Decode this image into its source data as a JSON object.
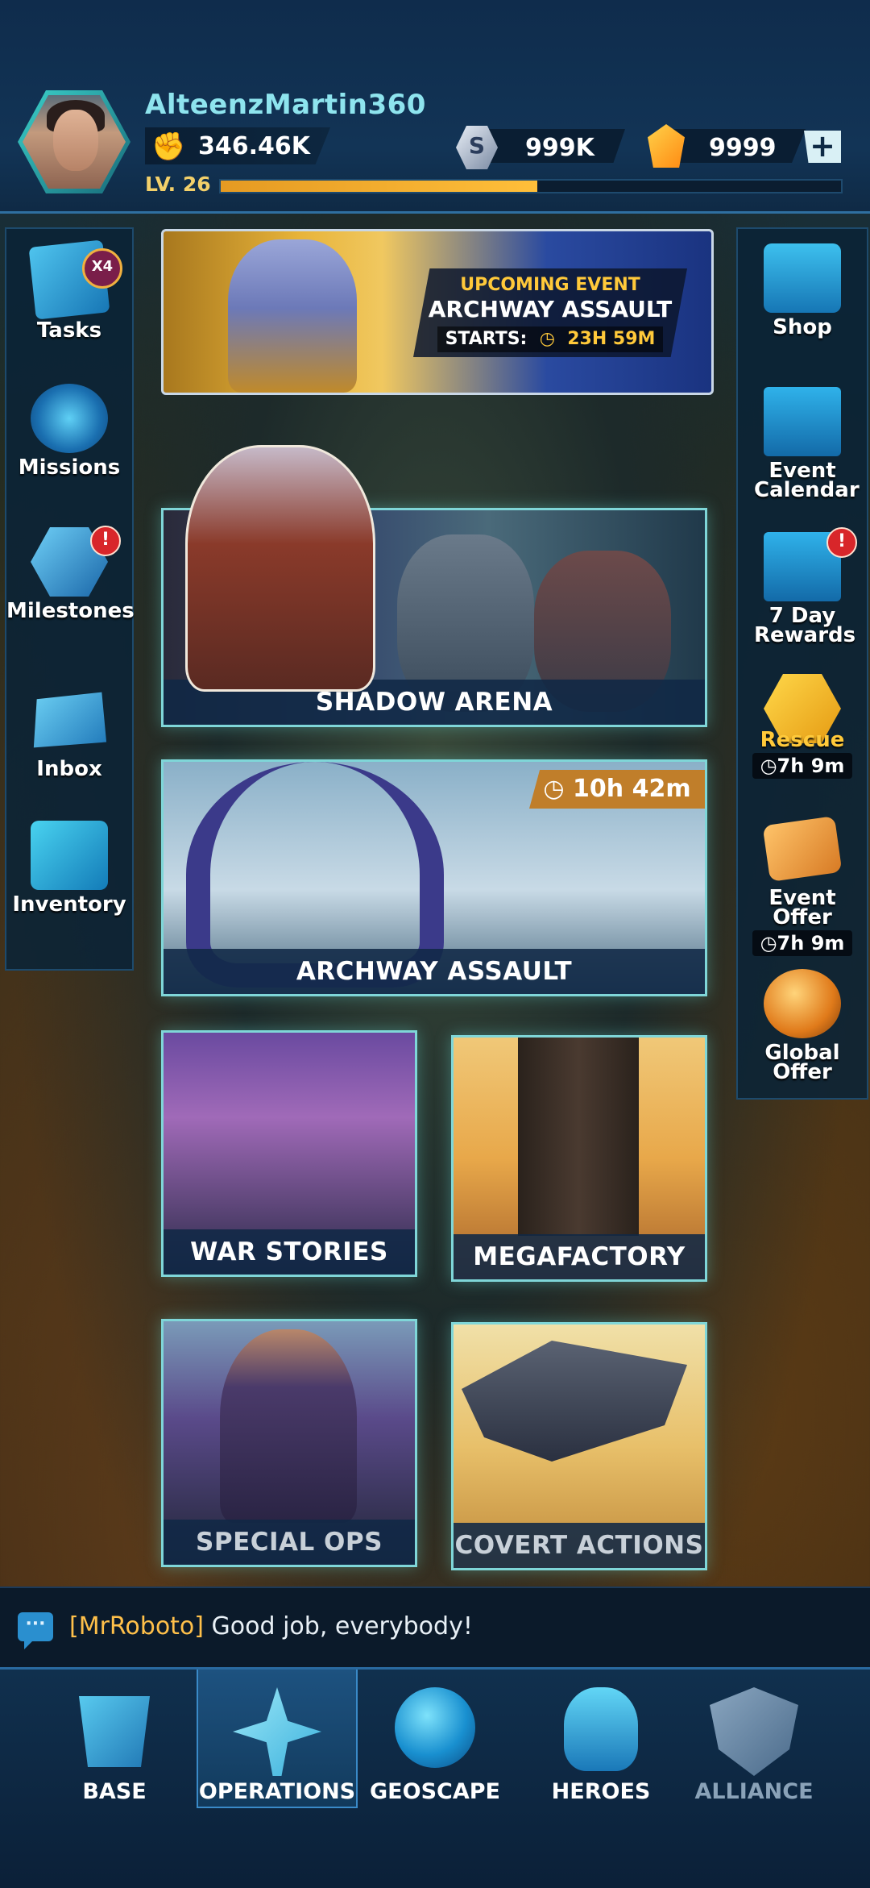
{
  "header": {
    "username": "AlteenzMartin360",
    "power": "346.46K",
    "currency_s_symbol": "S",
    "currency_s": "999K",
    "currency_crystal": "9999",
    "plus_label": "+",
    "level": "LV. 26",
    "xp_progress": 0.51
  },
  "event_banner": {
    "upcoming": "UPCOMING EVENT",
    "name": "ARCHWAY ASSAULT",
    "starts_label": "STARTS:",
    "starts_time": "23H 59M"
  },
  "left_sidebar": {
    "items": [
      {
        "label": "Tasks",
        "badge": "X4",
        "icon": "tasks-icon"
      },
      {
        "label": "Missions",
        "icon": "radar-icon"
      },
      {
        "label": "Milestones",
        "alert": "!",
        "icon": "milestone-star-icon"
      },
      {
        "label": "Inbox",
        "icon": "envelope-icon"
      },
      {
        "label": "Inventory",
        "icon": "crate-icon"
      }
    ]
  },
  "right_sidebar": {
    "items": [
      {
        "label": "Shop",
        "icon": "treasure-chest-icon"
      },
      {
        "label": "Event Calendar",
        "icon": "calendar-icon"
      },
      {
        "label": "7 Day Rewards",
        "alert": "!",
        "icon": "calendar-icon"
      },
      {
        "label": "Rescue",
        "timer": "7h 9m",
        "icon": "rescue-portrait-icon"
      },
      {
        "label": "Event Offer",
        "timer": "7h 9m",
        "icon": "ticket-icon"
      },
      {
        "label": "Global Offer",
        "icon": "globe-icon"
      }
    ]
  },
  "cards": {
    "shadow_arena": "SHADOW ARENA",
    "archway_assault": "ARCHWAY ASSAULT",
    "archway_timer": "10h 42m",
    "war_stories": "WAR STORIES",
    "megafactory": "MEGAFACTORY",
    "special_ops": "SPECIAL OPS",
    "covert_actions": "COVERT ACTIONS"
  },
  "chat": {
    "user": "[MrRoboto]",
    "message": "Good job, everybody!"
  },
  "nav": {
    "items": [
      {
        "label": "BASE",
        "icon": "base-icon"
      },
      {
        "label": "OPERATIONS",
        "icon": "jet-icon",
        "active": true
      },
      {
        "label": "GEOSCAPE",
        "icon": "globe-icon"
      },
      {
        "label": "HEROES",
        "icon": "helmet-icon"
      },
      {
        "label": "ALLIANCE",
        "icon": "lock-icon",
        "locked": true
      }
    ]
  },
  "colors": {
    "accent_gold": "#ffc93a",
    "teal_frame": "#7fd6d8",
    "header_bg": "#123456"
  }
}
